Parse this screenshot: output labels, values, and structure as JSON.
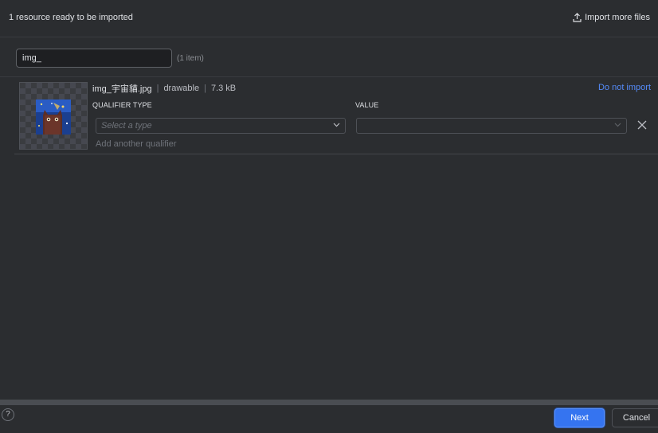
{
  "header": {
    "title": "1 resource ready to be imported",
    "import_more_label": "Import more files"
  },
  "filter": {
    "value": "img_",
    "count_label": "(1 item)"
  },
  "resource": {
    "file_name": "img_宇宙貓.jpg",
    "type": "drawable",
    "size": "7.3 kB",
    "do_not_import_label": "Do not import",
    "qualifier_type_header": "QUALIFIER TYPE",
    "value_header": "VALUE",
    "qualifier_type_placeholder": "Select a type",
    "value_selected": "",
    "add_qualifier_label": "Add another qualifier"
  },
  "footer": {
    "help_label": "?",
    "next_label": "Next",
    "cancel_label": "Cancel"
  },
  "icons": {
    "import": "upload-icon",
    "remove": "close-icon",
    "dropdown": "chevron-down-icon",
    "help": "help-icon"
  },
  "colors": {
    "background": "#2b2d30",
    "accent": "#3574f0",
    "link": "#548af7"
  }
}
